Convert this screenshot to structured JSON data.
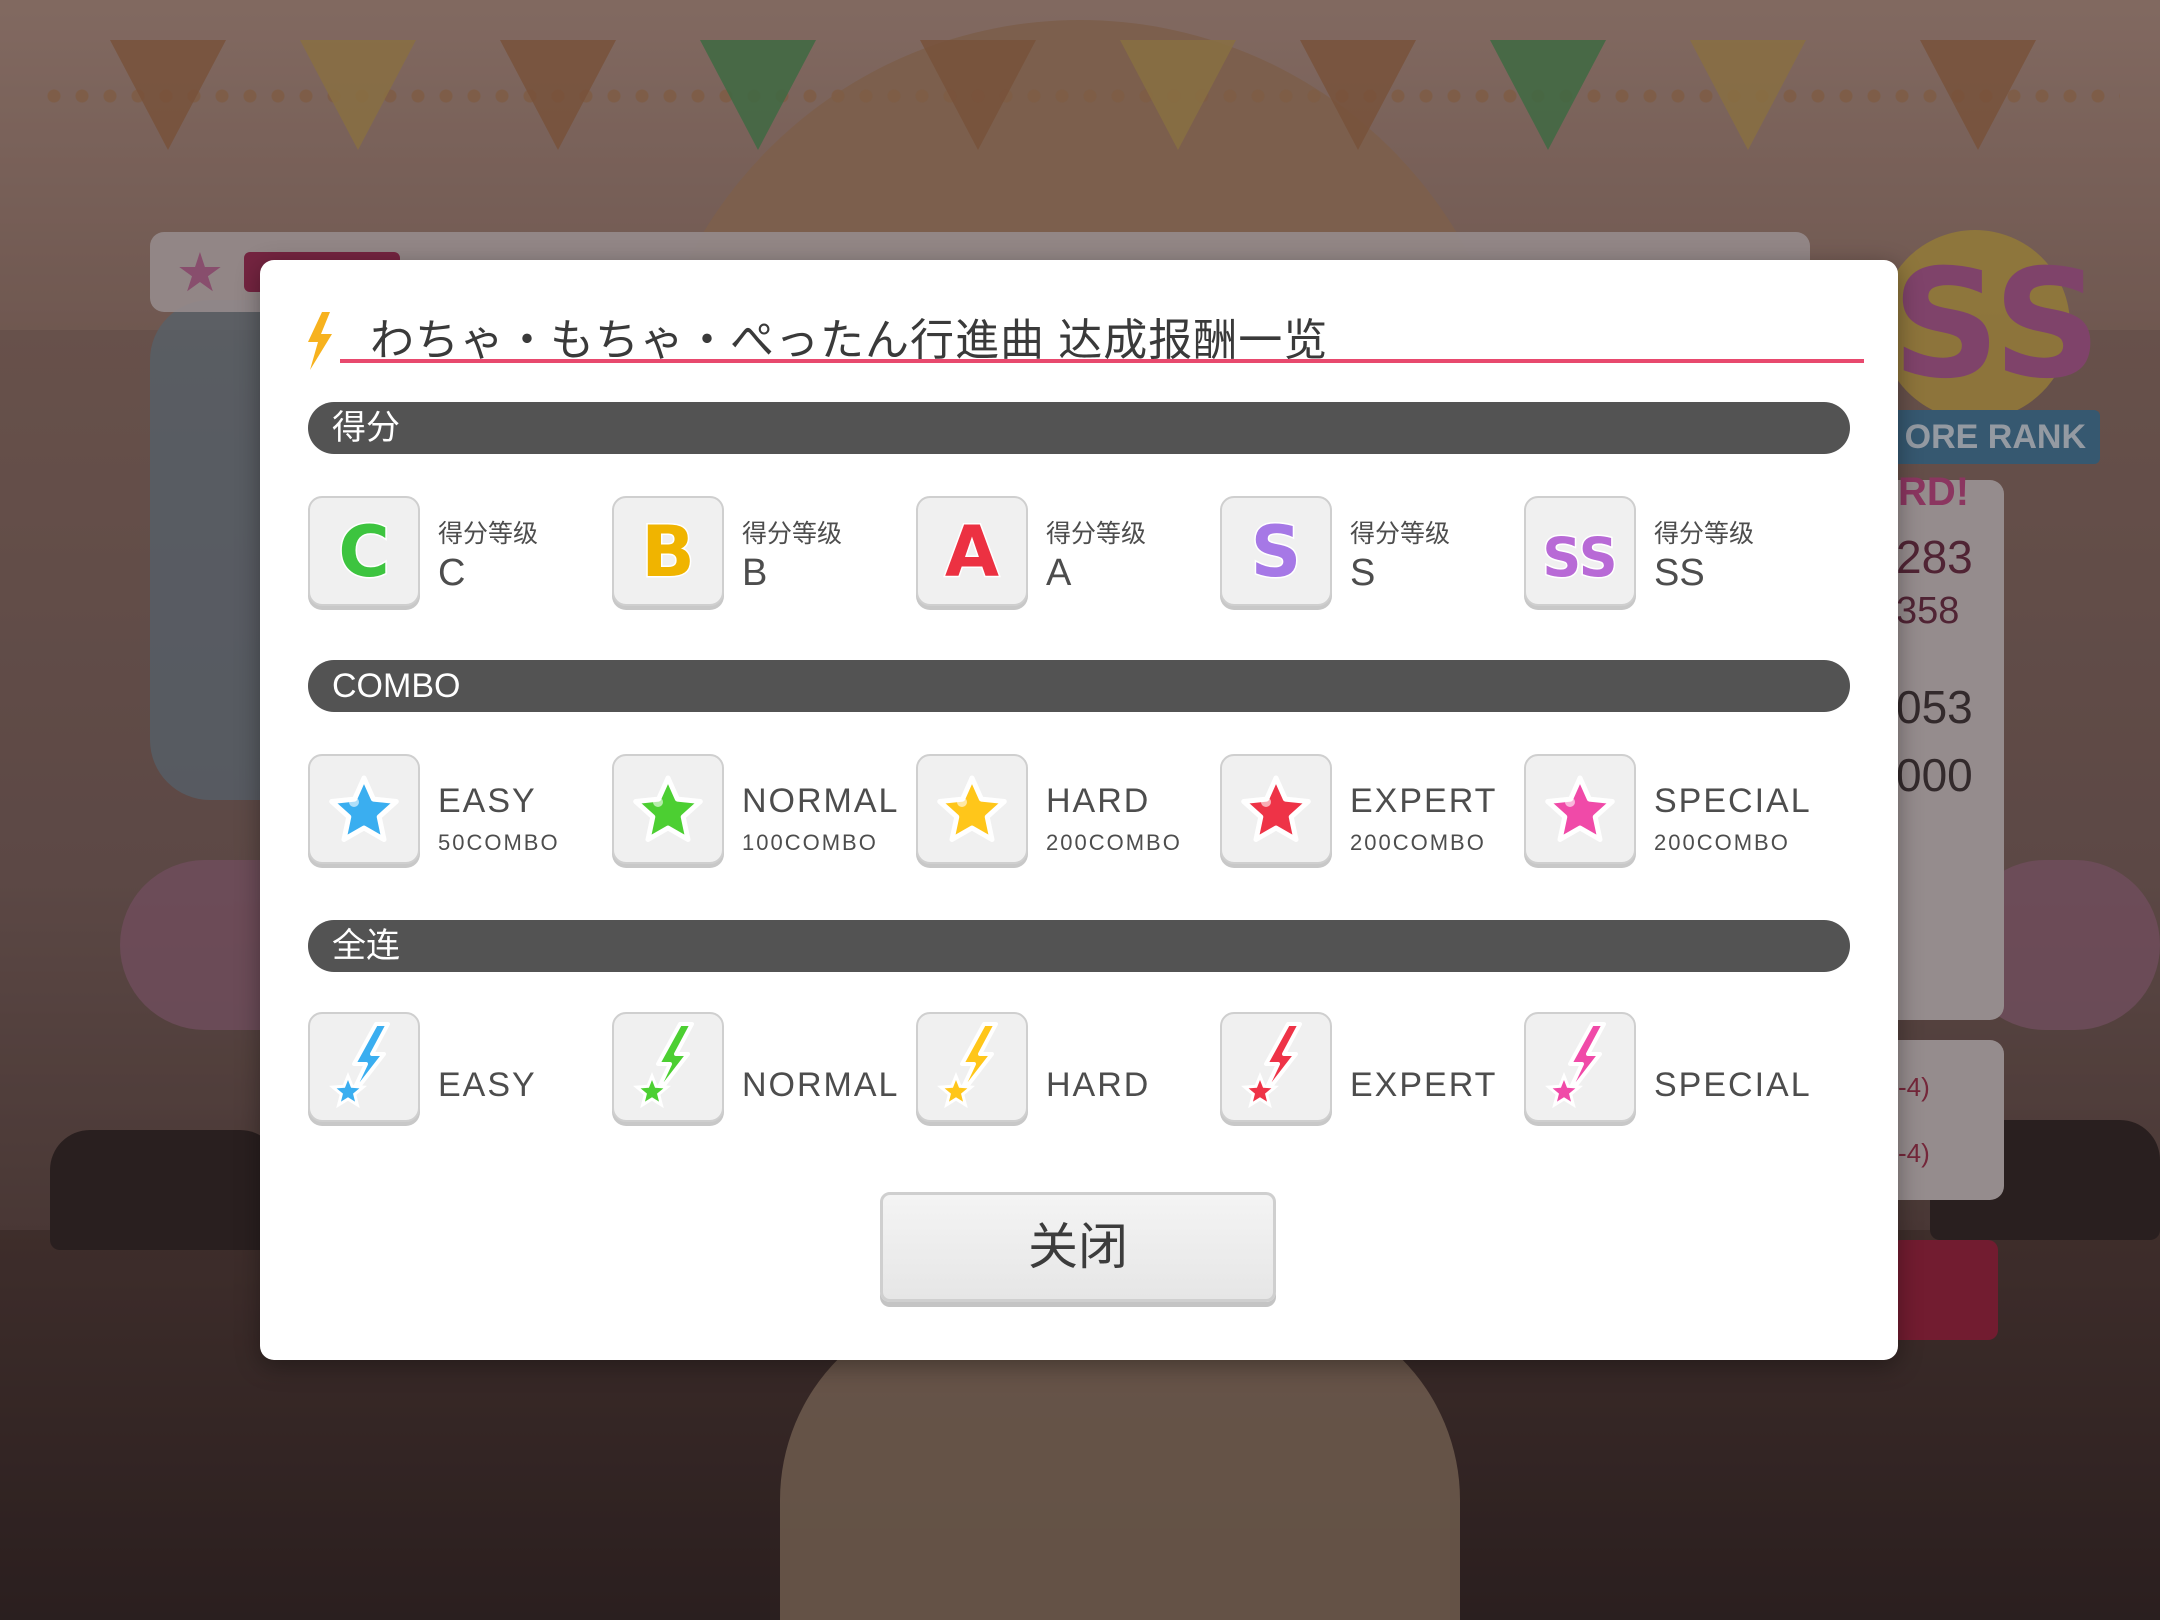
{
  "background": {
    "rank_label": "ORE RANK",
    "rank_badge": "SS",
    "record_partial": "RD!",
    "num1": "283",
    "num2": "358",
    "num3": "053",
    "num4": "000",
    "small1": "-4)",
    "small2": "-4)"
  },
  "modal": {
    "title": "わちゃ・もちゃ・ぺったん行進曲 达成报酬一览",
    "sections": {
      "score": {
        "label": "得分",
        "items": [
          {
            "grade": "C",
            "caption": "得分等级",
            "value": "C",
            "color": "#3dc43f"
          },
          {
            "grade": "B",
            "caption": "得分等级",
            "value": "B",
            "color": "#f0b400"
          },
          {
            "grade": "A",
            "caption": "得分等级",
            "value": "A",
            "color": "#ec3142"
          },
          {
            "grade": "S",
            "caption": "得分等级",
            "value": "S",
            "color": "#a678e6"
          },
          {
            "grade": "SS",
            "caption": "得分等级",
            "value": "SS",
            "color": "#b86ad6"
          }
        ]
      },
      "combo": {
        "label": "COMBO",
        "items": [
          {
            "difficulty": "EASY",
            "requirement": "50COMBO",
            "color": "#3aaef0"
          },
          {
            "difficulty": "NORMAL",
            "requirement": "100COMBO",
            "color": "#4ccf32"
          },
          {
            "difficulty": "HARD",
            "requirement": "200COMBO",
            "color": "#ffc61a"
          },
          {
            "difficulty": "EXPERT",
            "requirement": "200COMBO",
            "color": "#ee3347"
          },
          {
            "difficulty": "SPECIAL",
            "requirement": "200COMBO",
            "color": "#f04aa8"
          }
        ]
      },
      "full_combo": {
        "label": "全连",
        "items": [
          {
            "difficulty": "EASY",
            "color": "#3aaef0"
          },
          {
            "difficulty": "NORMAL",
            "color": "#4ccf32"
          },
          {
            "difficulty": "HARD",
            "color": "#ffc61a"
          },
          {
            "difficulty": "EXPERT",
            "color": "#ee3347"
          },
          {
            "difficulty": "SPECIAL",
            "color": "#f04aa8"
          }
        ]
      }
    },
    "close_label": "关闭"
  }
}
